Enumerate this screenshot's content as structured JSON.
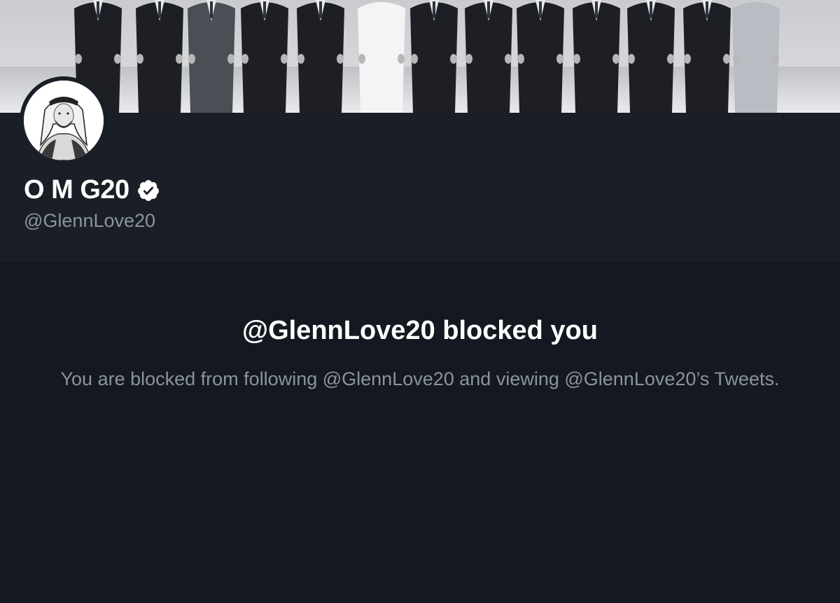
{
  "header": {
    "banner_alt": "group photo banner"
  },
  "profile": {
    "display_name": "O M G20",
    "handle": "@GlennLove20",
    "verified": true
  },
  "blocked_notice": {
    "title": "@GlennLove20 blocked you",
    "message": "You are blocked from following @GlennLove20 and viewing @GlennLove20’s Tweets."
  },
  "icons": {
    "verified": "verified-badge-icon"
  },
  "colors": {
    "background": "#141820",
    "profile_section": "#1a1f27",
    "primary_text": "#ffffff",
    "secondary_text": "#8b939e"
  }
}
